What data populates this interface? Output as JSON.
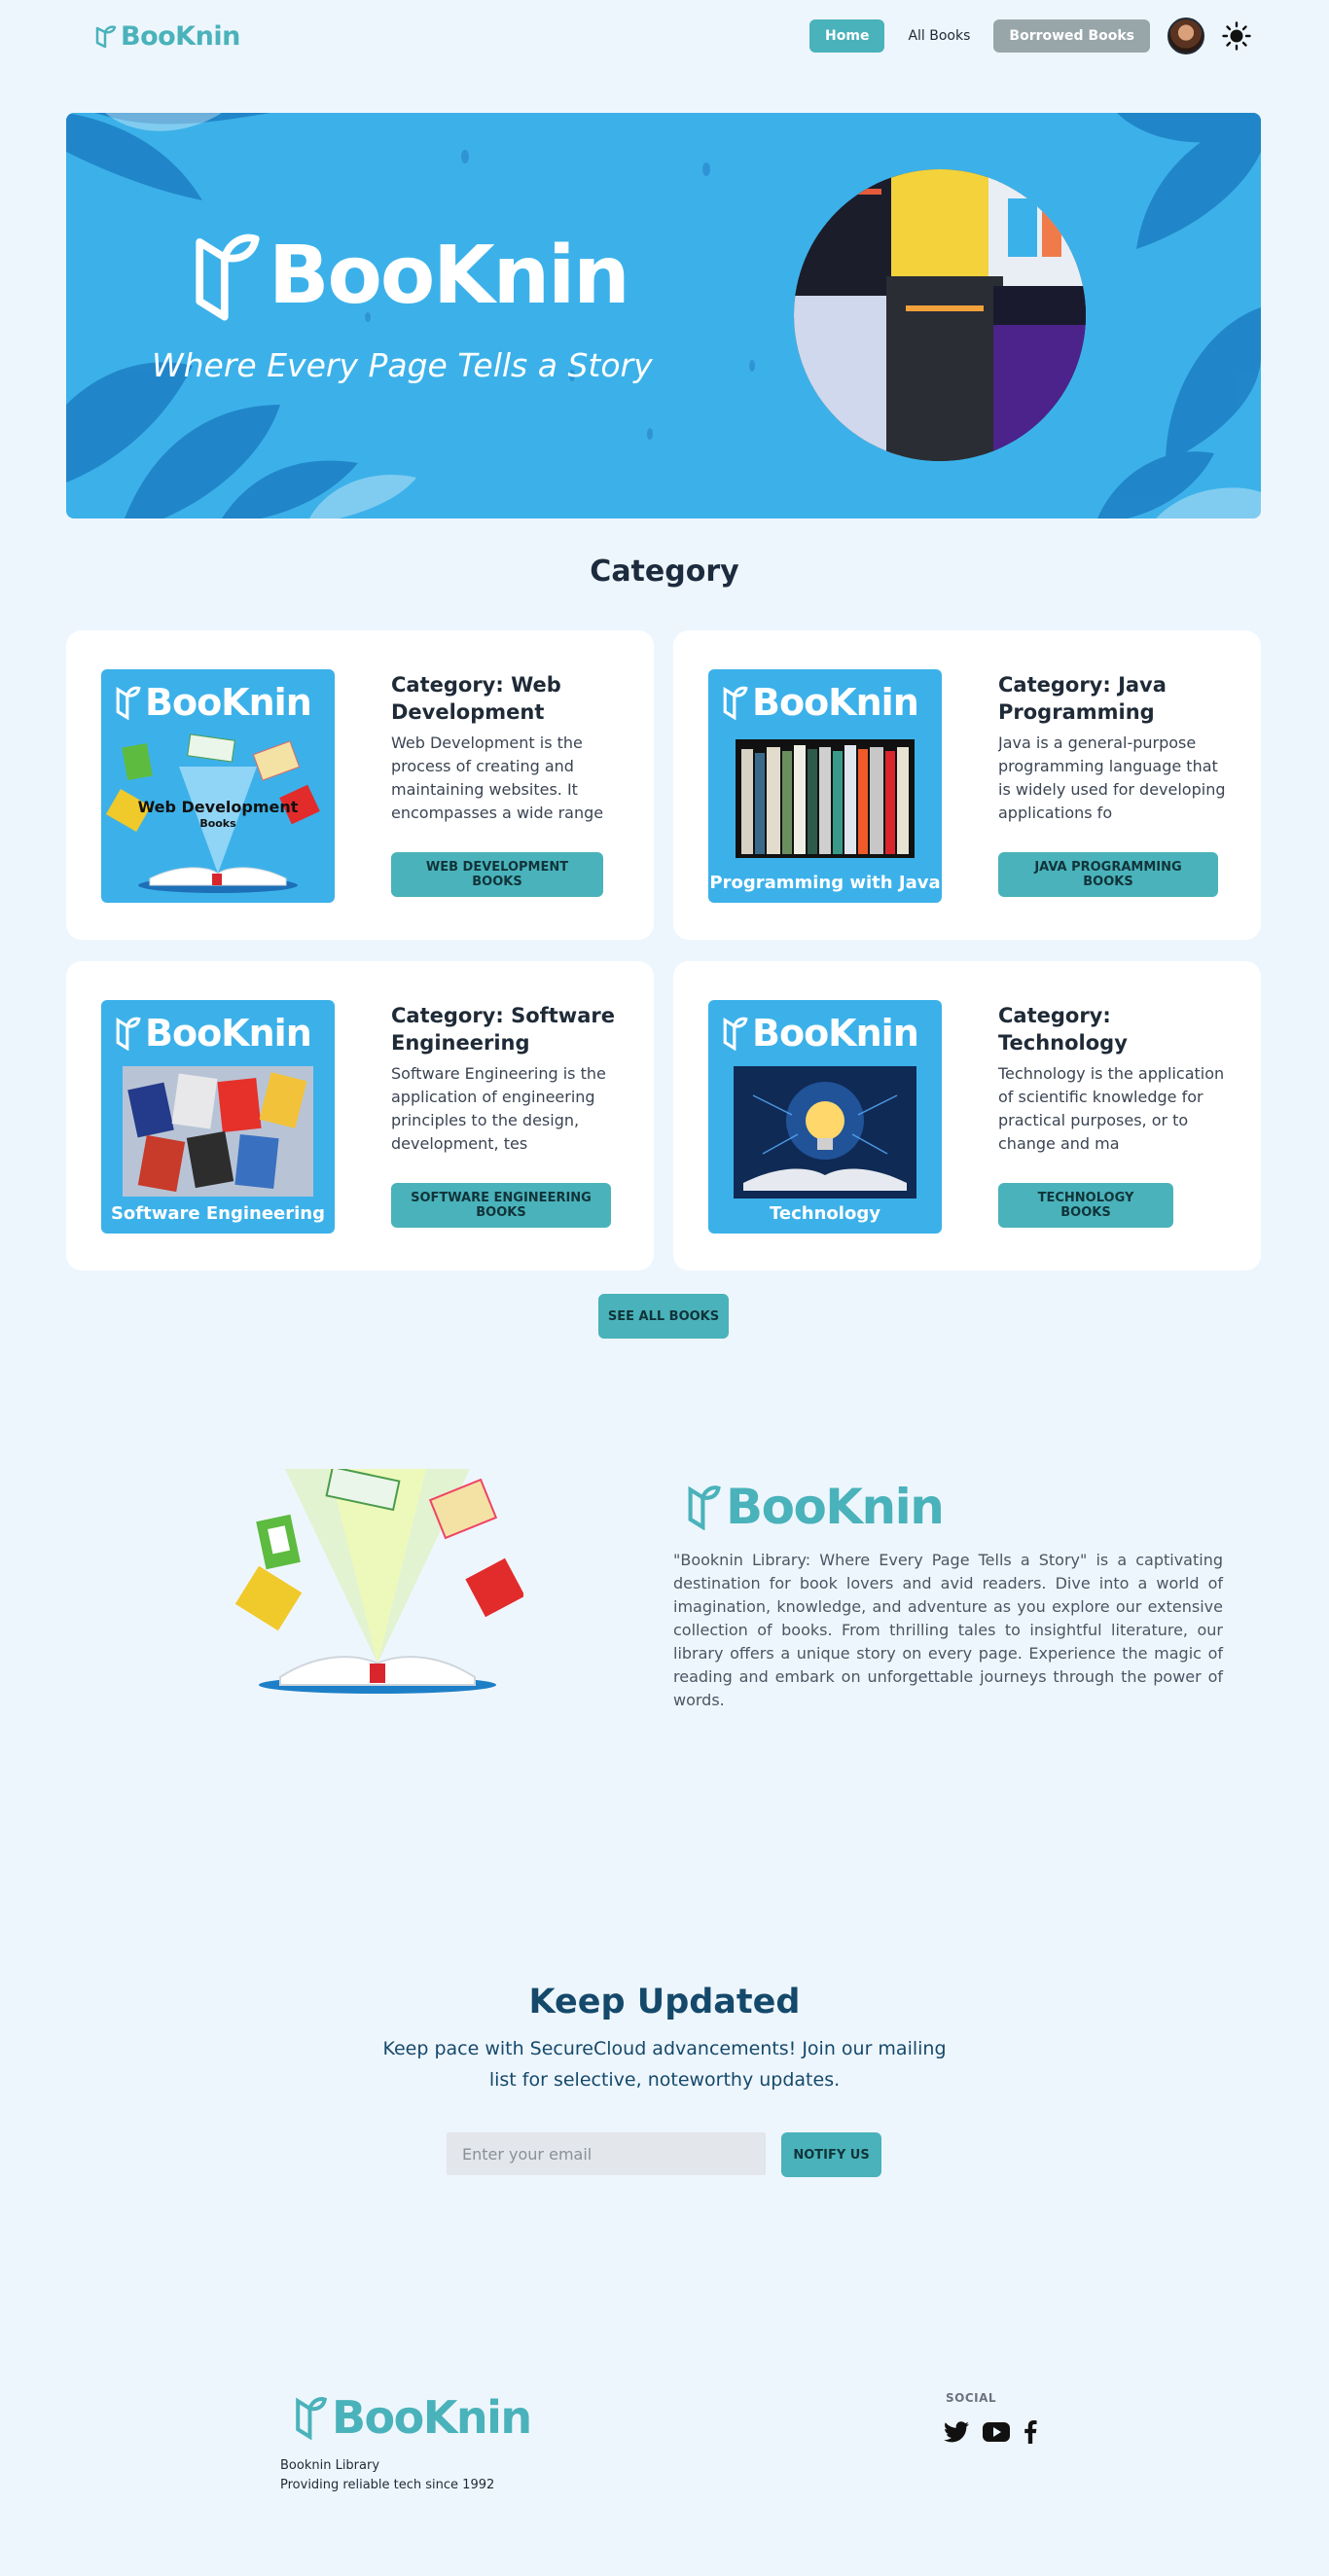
{
  "nav": {
    "logo": "BooKnin",
    "home": "Home",
    "all_books": "All Books",
    "borrowed": "Borrowed Books"
  },
  "hero": {
    "title": "BooKnin",
    "tagline": "Where Every Page Tells a Story"
  },
  "category": {
    "heading": "Category",
    "cards": [
      {
        "title": "Category: Web Development",
        "desc": "Web Development is the process of creating and maintaining websites. It encompasses a wide range",
        "button": "WEB DEVELOPMENT BOOKS",
        "image_logo": "BooKnin",
        "image_caption": "Web Development",
        "image_sub": "Books"
      },
      {
        "title": "Category: Java Programming",
        "desc": "Java is a general-purpose programming language that is widely used for developing applications fo",
        "button": "JAVA PROGRAMMING BOOKS",
        "image_logo": "BooKnin",
        "image_caption": "Programming with Java"
      },
      {
        "title": "Category: Software Engineering",
        "desc": "Software Engineering is the application of engineering principles to the design, development, tes",
        "button": "SOFTWARE ENGINEERING BOOKS",
        "image_logo": "BooKnin",
        "image_caption": "Software Engineering"
      },
      {
        "title": "Category: Technology",
        "desc": "Technology is the application of scientific knowledge for practical purposes, or to change and ma",
        "button": "TECHNOLOGY BOOKS",
        "image_logo": "BooKnin",
        "image_caption": "Technology"
      }
    ],
    "see_all": "SEE ALL BOOKS"
  },
  "about": {
    "logo": "BooKnin",
    "text": "\"Booknin Library: Where Every Page Tells a Story\" is a captivating destination for book lovers and avid readers. Dive into a world of imagination, knowledge, and adventure as you explore our extensive collection of books. From thrilling tales to insightful literature, our library offers a unique story on every page. Experience the magic of reading and embark on unforgettable journeys through the power of words."
  },
  "newsletter": {
    "title": "Keep Updated",
    "subtitle": "Keep pace with SecureCloud advancements! Join our mailing list for selective, noteworthy updates.",
    "placeholder": "Enter your email",
    "button": "NOTIFY US"
  },
  "footer": {
    "logo": "BooKnin",
    "line1": "Booknin Library",
    "line2": "Providing reliable tech since 1992",
    "social_label": "SOCIAL",
    "icons": [
      "twitter-icon",
      "youtube-icon",
      "facebook-icon"
    ]
  },
  "colors": {
    "accent": "#4ab2ba",
    "hero_blue": "#3cb1e9",
    "page_bg": "#eef6fd",
    "heading_dark": "#15496b"
  }
}
